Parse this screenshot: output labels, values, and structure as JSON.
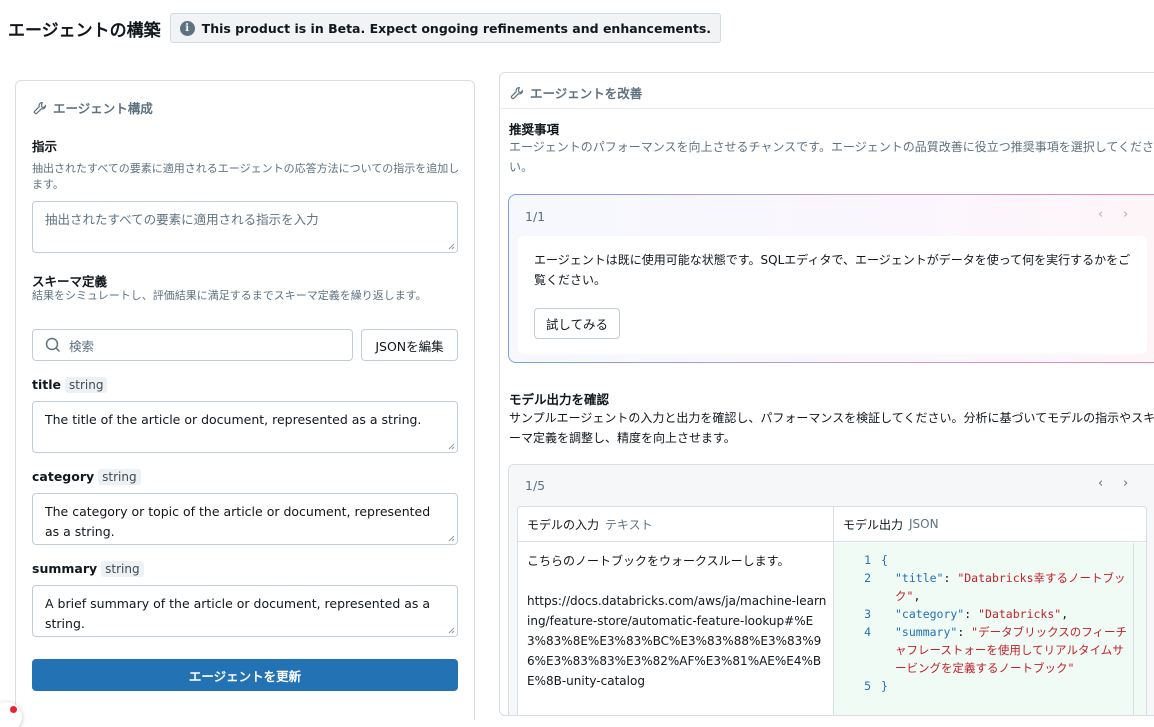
{
  "header": {
    "title": "エージェントの構築",
    "beta_icon": "info-icon",
    "beta_text": "This product is in Beta. Expect ongoing refinements and enhancements."
  },
  "left_panel": {
    "title": "エージェント構成",
    "icon": "wrench-icon",
    "instructions": {
      "label": "指示",
      "description": "抽出されたすべての要素に適用されるエージェントの応答方法についての指示を追加します。",
      "placeholder": "抽出されたすべての要素に適用される指示を入力"
    },
    "schema": {
      "label": "スキーマ定義",
      "description": "結果をシミュレートし、評価結果に満足するまでスキーマ定義を繰り返します。",
      "search_placeholder": "検索",
      "edit_json_button": "JSONを編集",
      "fields": [
        {
          "name": "title",
          "type": "string",
          "value": "The title of the article or document, represented as a string."
        },
        {
          "name": "category",
          "type": "string",
          "value": "The category or topic of the article or document, represented as a string."
        },
        {
          "name": "summary",
          "type": "string",
          "value": "A brief summary of the article or document, represented as a string."
        }
      ]
    },
    "update_button": "エージェントを更新"
  },
  "right_panel": {
    "title": "エージェントを改善",
    "icon": "wrench-icon",
    "recommendations": {
      "label": "推奨事項",
      "description": "エージェントのパフォーマンスを向上させるチャンスです。エージェントの品質改善に役立つ推奨事項を選択してください。",
      "counter": "1/1",
      "message": "エージェントは既に使用可能な状態です。SQLエディタで、エージェントがデータを使って何を実行するかをご覧ください。",
      "try_button": "試してみる"
    },
    "model_output": {
      "label": "モデル出力を確認",
      "description": "サンプルエージェントの入力と出力を確認し、パフォーマンスを検証してください。分析に基づいてモデルの指示やスキーマ定義を調整し、精度を向上させます。",
      "counter": "1/5",
      "input_header": "モデルの入力",
      "input_type": "テキスト",
      "output_header": "モデル出力",
      "output_type": "JSON",
      "input_line1": "こちらのノートブックをウォークスルーします。",
      "input_url": "https://docs.databricks.com/aws/ja/machine-learning/feature-store/automatic-feature-lookup#%E3%83%8E%E3%83%BC%E3%83%88%E3%83%96%E3%83%83%E3%82%AF%E3%81%AE%E4%BE%8B-unity-catalog",
      "output_json": {
        "title_key": "\"title\"",
        "title_val": "\"Databricks幸するノートブック\"",
        "category_key": "\"category\"",
        "category_val": "\"Databricks\"",
        "summary_key": "\"summary\"",
        "summary_val": "\"データブリックスのフィーチャフレーストォーを使用してリアルタイムサービングを定義するノートブック\""
      }
    }
  },
  "colors": {
    "primary": "#2272b4",
    "json_key": "#2272b4",
    "json_string": "#c4212b"
  }
}
